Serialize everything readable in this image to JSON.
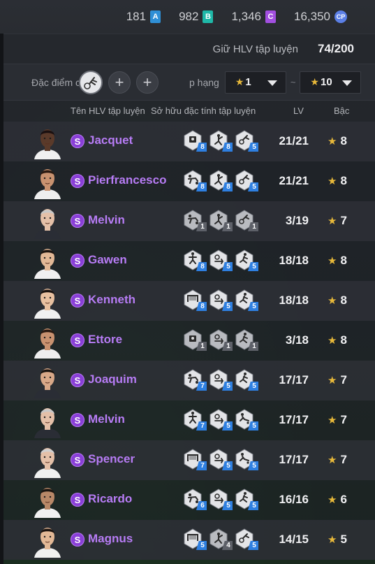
{
  "currency": [
    {
      "value": "181",
      "badge": "A",
      "color": "#2f8fd6",
      "round": false
    },
    {
      "value": "982",
      "badge": "B",
      "color": "#1fb8a8",
      "round": false
    },
    {
      "value": "1,346",
      "badge": "C",
      "color": "#a24fe0",
      "round": false
    },
    {
      "value": "16,350",
      "badge": "CP",
      "color": "#5b7fe6",
      "round": true
    }
  ],
  "limit": {
    "label": "Giữ HLV tập luyện",
    "value": "74/200"
  },
  "filter": {
    "trait_label": "Đặc điểm c",
    "rank_label": "p hạng",
    "min_rank": "1",
    "tilde": "~",
    "max_rank": "10"
  },
  "columns": {
    "name": "Tên HLV tập luyện",
    "owned": "Sở hữu đặc tính tập luyện",
    "lv": "LV",
    "grade": "Bậc"
  },
  "coaches": [
    {
      "name": "Jacquet",
      "badge": "S",
      "lv": "21/21",
      "grade": "8",
      "skin": "#5a3a2a",
      "hair": "#1a1010",
      "shirt": "#f0f0f0",
      "traits": [
        {
          "icon": "shield-icon",
          "level": "8",
          "color": "blue"
        },
        {
          "icon": "kick-icon",
          "level": "8",
          "color": "blue"
        },
        {
          "icon": "dribble-icon",
          "level": "5",
          "color": "blue"
        }
      ]
    },
    {
      "name": "Pierfrancesco",
      "badge": "S",
      "lv": "21/21",
      "grade": "8",
      "skin": "#c89270",
      "hair": "#2a1a12",
      "shirt": "#eeeeee",
      "traits": [
        {
          "icon": "tackle-icon",
          "level": "8",
          "color": "blue"
        },
        {
          "icon": "kick-icon",
          "level": "8",
          "color": "blue"
        },
        {
          "icon": "dribble-icon",
          "level": "5",
          "color": "blue"
        }
      ]
    },
    {
      "name": "Melvin",
      "badge": "S",
      "lv": "3/19",
      "grade": "7",
      "skin": "#e4c0a8",
      "hair": "#c8c8c8",
      "shirt": "#2a2d35",
      "traits": [
        {
          "icon": "tackle-icon",
          "level": "1",
          "color": "grey"
        },
        {
          "icon": "kick-icon",
          "level": "1",
          "color": "grey"
        },
        {
          "icon": "dribble-icon",
          "level": "1",
          "color": "grey"
        }
      ]
    },
    {
      "name": "Gawen",
      "badge": "S",
      "lv": "18/18",
      "grade": "8",
      "skin": "#e2b896",
      "hair": "#1c1410",
      "shirt": "#f0f0f0",
      "traits": [
        {
          "icon": "header-icon",
          "level": "8",
          "color": "blue"
        },
        {
          "icon": "ball-control-icon",
          "level": "5",
          "color": "blue"
        },
        {
          "icon": "run-icon",
          "level": "5",
          "color": "blue"
        }
      ]
    },
    {
      "name": "Kenneth",
      "badge": "S",
      "lv": "18/18",
      "grade": "8",
      "skin": "#e8c0a0",
      "hair": "#1a1210",
      "shirt": "#f0f0f0",
      "traits": [
        {
          "icon": "goal-icon",
          "level": "8",
          "color": "blue"
        },
        {
          "icon": "ball-control-icon",
          "level": "5",
          "color": "blue"
        },
        {
          "icon": "run-icon",
          "level": "5",
          "color": "blue"
        }
      ]
    },
    {
      "name": "Ettore",
      "badge": "S",
      "lv": "3/18",
      "grade": "8",
      "skin": "#c89270",
      "hair": "#2a1a12",
      "shirt": "#eeeeee",
      "traits": [
        {
          "icon": "shield-icon",
          "level": "1",
          "color": "grey"
        },
        {
          "icon": "ball-control-icon",
          "level": "1",
          "color": "grey"
        },
        {
          "icon": "run-icon",
          "level": "1",
          "color": "grey"
        }
      ]
    },
    {
      "name": "Joaquim",
      "badge": "S",
      "lv": "17/17",
      "grade": "7",
      "skin": "#d8a888",
      "hair": "#1a1410",
      "shirt": "#2a2d35",
      "traits": [
        {
          "icon": "tackle-icon",
          "level": "7",
          "color": "blue"
        },
        {
          "icon": "ball-control-icon",
          "level": "5",
          "color": "blue"
        },
        {
          "icon": "run-icon",
          "level": "5",
          "color": "blue"
        }
      ]
    },
    {
      "name": "Melvin",
      "badge": "S",
      "lv": "17/17",
      "grade": "7",
      "skin": "#e4c0a8",
      "hair": "#c8c8c8",
      "shirt": "#2a2d35",
      "traits": [
        {
          "icon": "header-icon",
          "level": "7",
          "color": "blue"
        },
        {
          "icon": "ball-control-icon",
          "level": "5",
          "color": "blue"
        },
        {
          "icon": "slide-icon",
          "level": "5",
          "color": "blue"
        }
      ]
    },
    {
      "name": "Spencer",
      "badge": "S",
      "lv": "17/17",
      "grade": "7",
      "skin": "#e4c0a8",
      "hair": "#d0d0d0",
      "shirt": "#f0f0f0",
      "traits": [
        {
          "icon": "goal-icon",
          "level": "7",
          "color": "blue"
        },
        {
          "icon": "ball-control-icon",
          "level": "5",
          "color": "blue"
        },
        {
          "icon": "slide-icon",
          "level": "5",
          "color": "blue"
        }
      ]
    },
    {
      "name": "Ricardo",
      "badge": "S",
      "lv": "16/16",
      "grade": "6",
      "skin": "#b88868",
      "hair": "#1a1410",
      "shirt": "#f0f0f0",
      "traits": [
        {
          "icon": "tackle-icon",
          "level": "6",
          "color": "blue"
        },
        {
          "icon": "ball-control-icon",
          "level": "5",
          "color": "blue"
        },
        {
          "icon": "run-icon",
          "level": "5",
          "color": "blue"
        }
      ]
    },
    {
      "name": "Magnus",
      "badge": "S",
      "lv": "14/15",
      "grade": "5",
      "skin": "#e2b896",
      "hair": "#1c1410",
      "shirt": "#f0f0f0",
      "traits": [
        {
          "icon": "goal-icon",
          "level": "5",
          "color": "blue"
        },
        {
          "icon": "kick-icon",
          "level": "4",
          "color": "grey"
        },
        {
          "icon": "dribble-icon",
          "level": "5",
          "color": "blue"
        }
      ]
    }
  ]
}
